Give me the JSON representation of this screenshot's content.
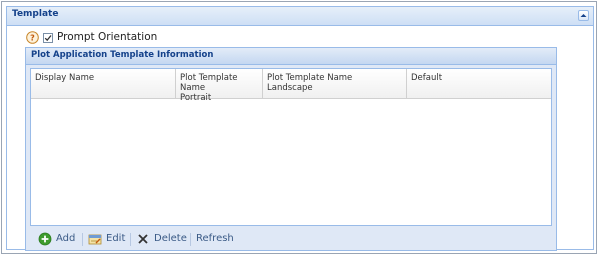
{
  "panel": {
    "title": "Template",
    "collapse_icon": "chevron-up-icon"
  },
  "options": {
    "help_icon": "help-icon",
    "prompt_orientation": {
      "label": "Prompt Orientation",
      "checked": true
    }
  },
  "grid": {
    "title": "Plot Application Template Information",
    "columns": [
      {
        "line1": "Display Name",
        "line2": ""
      },
      {
        "line1": "Plot Template Name",
        "line2": "Portrait"
      },
      {
        "line1": "Plot Template Name",
        "line2": "Landscape"
      },
      {
        "line1": "Default",
        "line2": ""
      }
    ],
    "rows": []
  },
  "toolbar": {
    "add_label": "Add",
    "edit_label": "Edit",
    "delete_label": "Delete",
    "refresh_label": "Refresh"
  },
  "colors": {
    "header_text": "#15428b",
    "border": "#99bbe8",
    "toolbar_text": "#3a5a86",
    "add_green": "#3e9b2e"
  }
}
